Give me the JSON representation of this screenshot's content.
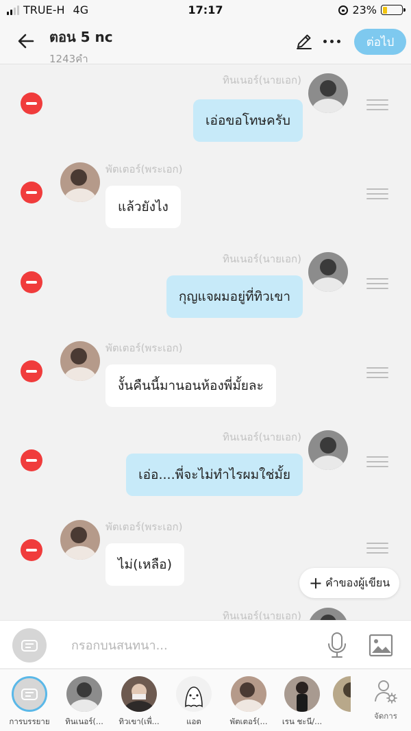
{
  "status_bar": {
    "carrier": "TRUE-H",
    "network": "4G",
    "time": "17:17",
    "battery": "23%"
  },
  "header": {
    "title": "ตอน 5 nc",
    "subtitle": "1243คำ",
    "next_label": "ต่อไป"
  },
  "messages": [
    {
      "side": "right",
      "name": "ทินเนอร์(นายเอก)",
      "text": "เอ่อขอโทษครับ"
    },
    {
      "side": "left",
      "name": "พัตเตอร์(พระเอก)",
      "text": "แล้วยังไง"
    },
    {
      "side": "right",
      "name": "ทินเนอร์(นายเอก)",
      "text": "กุญแจผมอยู่ที่ทิวเขา"
    },
    {
      "side": "left",
      "name": "พัตเตอร์(พระเอก)",
      "text": "งั้นคืนนี้มานอนห้องพี่มั้ยละ"
    },
    {
      "side": "right",
      "name": "ทินเนอร์(นายเอก)",
      "text": "เอ่อ....พี่จะไม่ทำไรผมใช่มั้ย"
    },
    {
      "side": "left",
      "name": "พัตเตอร์(พระเอก)",
      "text": "ไม่(เหลือ)"
    },
    {
      "side": "right",
      "name": "ทินเนอร์(นายเอก)",
      "text": ""
    }
  ],
  "writer_button": {
    "label": "คำของผู้เขียน"
  },
  "input": {
    "placeholder": "กรอกบนสนทนา..."
  },
  "characters": [
    {
      "name": "การบรรยาย",
      "icon": "narration-icon"
    },
    {
      "name": "ทินเนอร์(..."
    },
    {
      "name": "ทิวเขา(เพื่..."
    },
    {
      "name": "แอต",
      "icon": "cute-ghost-icon"
    },
    {
      "name": "พัตเตอร์(..."
    },
    {
      "name": "เรน ชะนี/..."
    },
    {
      "name": ""
    }
  ],
  "manage": {
    "label": "จัดการ"
  },
  "colors": {
    "accent": "#7ec9ef",
    "right_bubble": "#c7eaf9",
    "delete": "#f03c3c"
  }
}
